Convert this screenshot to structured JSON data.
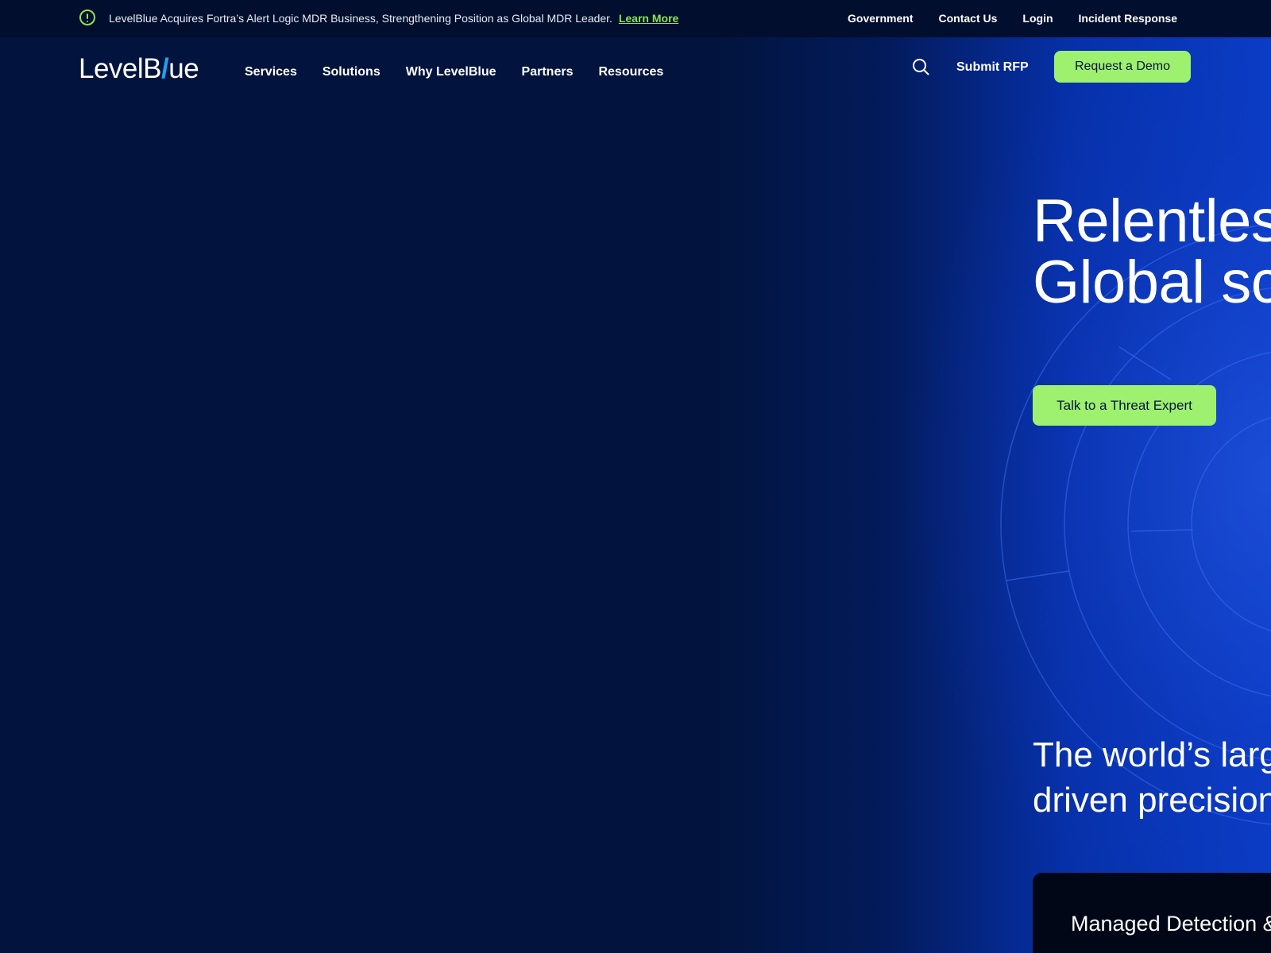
{
  "announcement": {
    "icon": "alert-circle-icon",
    "text": "LevelBlue Acquires Fortra’s Alert Logic MDR Business, Strengthening Position as Global MDR Leader.",
    "link_label": "Learn More",
    "accent_color": "#8be35a"
  },
  "utility_nav": [
    "Government",
    "Contact Us",
    "Login",
    "Incident Response"
  ],
  "logo": {
    "part1": "LevelB",
    "slash": "/",
    "part2": "ue",
    "slash_color": "#1fa2f3"
  },
  "main_nav": [
    "Services",
    "Solutions",
    "Why LevelBlue",
    "Partners",
    "Resources"
  ],
  "header_actions": {
    "search_icon": "search-icon",
    "submit_rfp": "Submit RFP",
    "request_demo": "Request a Demo",
    "cta_color": "#9ef06f"
  },
  "hero": {
    "title_lines": [
      "Relentless",
      "Global sc"
    ],
    "cta": "Talk to a Threat Expert",
    "subtitle_lines": [
      "The world’s larg",
      "driven precision"
    ],
    "card_title": "Managed Detection &"
  },
  "colors": {
    "background": "#02143d",
    "topbar": "#020e2d",
    "hero_blue": "#0a3cc4"
  }
}
